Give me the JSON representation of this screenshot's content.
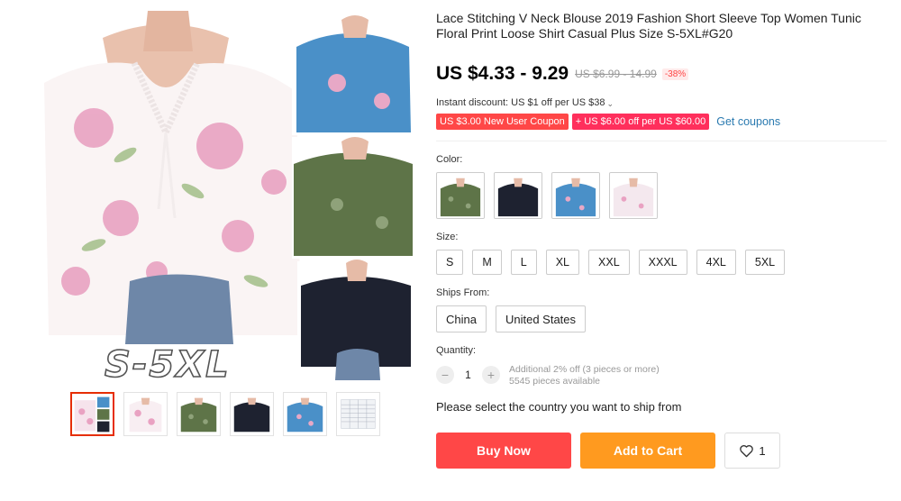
{
  "product": {
    "title": "Lace Stitching V Neck Blouse 2019 Fashion Short Sleeve Top Women Tunic Floral Print Loose Shirt Casual Plus Size S-5XL#G20",
    "price": "US $4.33 - 9.29",
    "original_price": "US $6.99 - 14.99",
    "discount": "-38%",
    "instant_discount": "Instant discount: US $1 off per US $38",
    "size_caption": "S-5XL"
  },
  "coupons": {
    "new_user": "US $3.00 New User Coupon",
    "store": "+ US $6.00 off per US $60.00",
    "get_link": "Get coupons"
  },
  "color": {
    "label": "Color:",
    "options": [
      {
        "name": "Green",
        "hex": "#5e7448"
      },
      {
        "name": "Black",
        "hex": "#1e2230"
      },
      {
        "name": "Blue",
        "hex": "#4a90c8"
      },
      {
        "name": "White",
        "hex": "#f4e8ee"
      }
    ]
  },
  "size": {
    "label": "Size:",
    "options": [
      "S",
      "M",
      "L",
      "XL",
      "XXL",
      "XXXL",
      "4XL",
      "5XL"
    ]
  },
  "ships_from": {
    "label": "Ships From:",
    "options": [
      "China",
      "United States"
    ]
  },
  "quantity": {
    "label": "Quantity:",
    "value": "1",
    "minus": "−",
    "plus": "+",
    "note": "Additional 2% off (3 pieces or more)",
    "available": "5545 pieces available"
  },
  "ship_note": "Please select the country you want to ship from",
  "actions": {
    "buy_now": "Buy Now",
    "add_to_cart": "Add to Cart",
    "wishlist_count": "1"
  },
  "icons": {
    "heart": "heart-icon",
    "chevron": "chevron-down-icon"
  },
  "colors": {
    "buy": "#ff4747",
    "cart": "#ff9a1f",
    "coupon_red": "#ff4747",
    "coupon_pink": "#ff2f5c",
    "link": "#2a7ab0"
  }
}
